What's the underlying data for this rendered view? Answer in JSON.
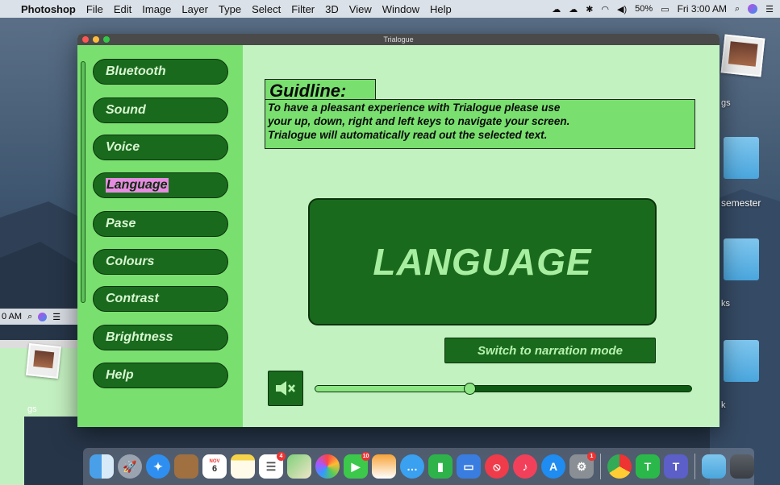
{
  "menubar": {
    "app_name": "Photoshop",
    "items": [
      "File",
      "Edit",
      "Image",
      "Layer",
      "Type",
      "Select",
      "Filter",
      "3D",
      "View",
      "Window",
      "Help"
    ],
    "battery": "50%",
    "clock": "Fri 3:00 AM"
  },
  "ghost_screen": {
    "clock": "0 AM",
    "label1": "gs"
  },
  "desktop": {
    "labels": [
      "gs",
      "semester",
      "ks",
      "k"
    ]
  },
  "window": {
    "title": "Trialogue",
    "sidebar": {
      "items": [
        {
          "label": "Bluetooth"
        },
        {
          "label": "Sound"
        },
        {
          "label": "Voice"
        },
        {
          "label": "Language",
          "selected": true
        },
        {
          "label": "Pase"
        },
        {
          "label": "Colours"
        },
        {
          "label": "Contrast"
        },
        {
          "label": "Brightness"
        },
        {
          "label": "Help"
        }
      ]
    },
    "guide": {
      "title": "Guidline:",
      "lines": [
        "To have a pleasant experience with Trialogue please use",
        "your up, down, right and left keys to navigate your screen.",
        "Trialogue will automatically read out the selected text."
      ]
    },
    "main_heading": "LANGUAGE",
    "narration_button": "Switch to narration mode",
    "volume_level": 0.41
  },
  "dock": {
    "icons": [
      "finder-icon",
      "launchpad-icon",
      "safari-icon",
      "notefile-icon",
      "calendar-icon",
      "notes-icon",
      "reminders-icon",
      "maps-icon",
      "photos-icon",
      "facetime-icon",
      "pages-icon",
      "messages-icon",
      "numbers-icon",
      "keynote-icon",
      "news-icon",
      "music-icon",
      "appstore-icon",
      "system-preferences-icon",
      "chrome-icon",
      "trialogue-icon",
      "teams-icon",
      "downloads-folder-icon",
      "trash-icon"
    ],
    "calendar_month": "NOV",
    "calendar_day": "6",
    "badges": {
      "reminders": "4",
      "facetime": "10",
      "sysprefs": "1"
    }
  },
  "colors": {
    "sidebar_bg": "#79e06f",
    "main_bg": "#c3f2c1",
    "button_dark": "#1a6a1e",
    "selected_highlight": "#e58ce0"
  }
}
